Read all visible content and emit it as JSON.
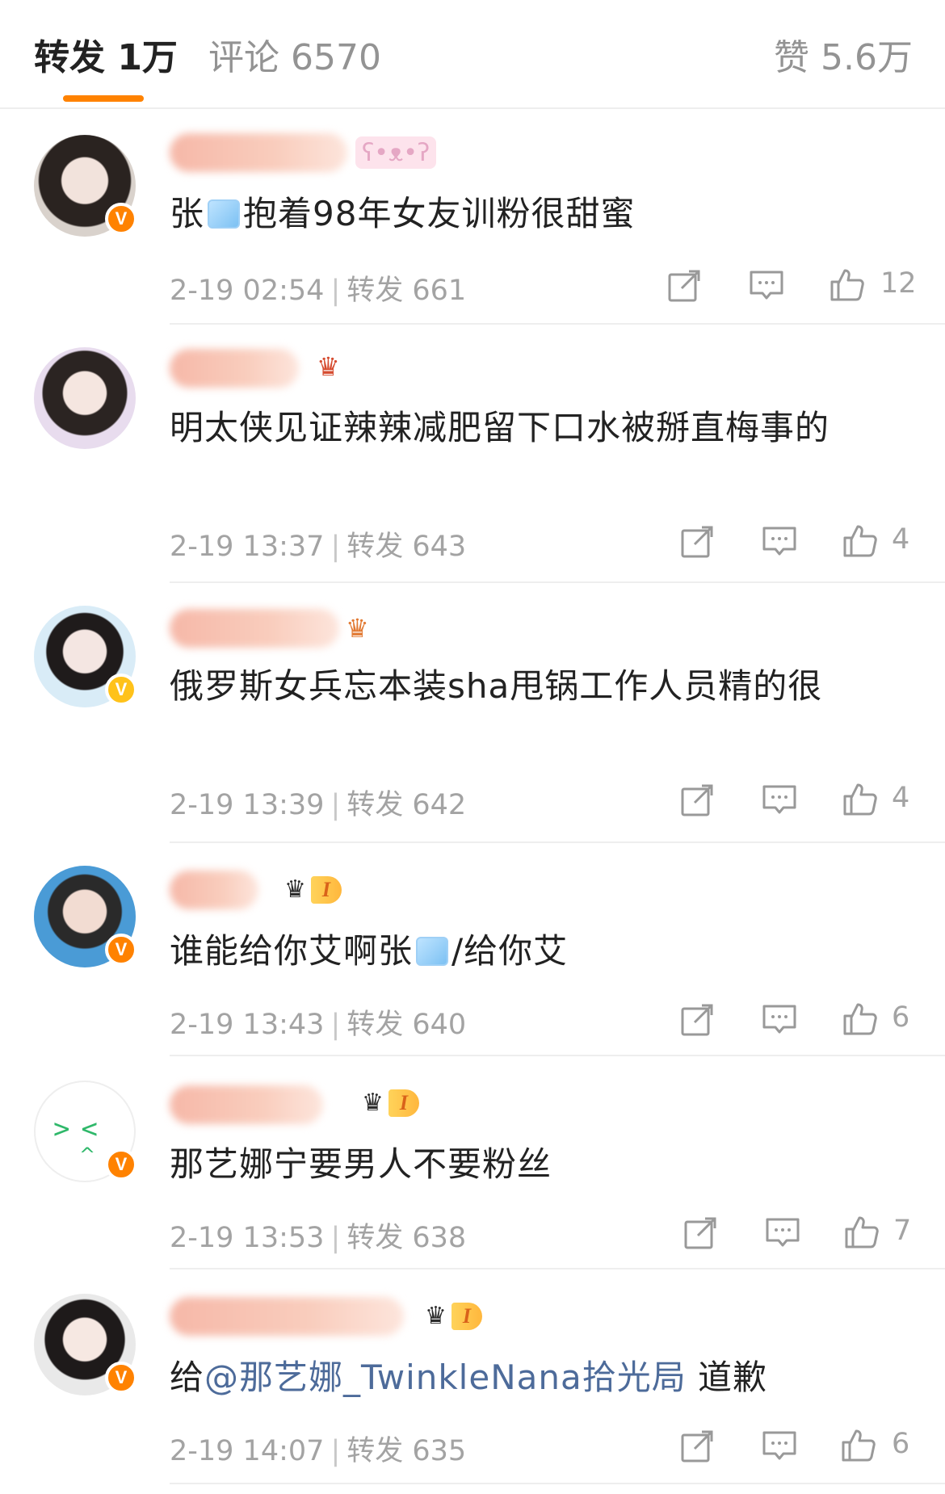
{
  "tabs": {
    "repost": "转发 1万",
    "comments": "评论 6570",
    "likes": "赞 5.6万"
  },
  "colors": {
    "accent": "#ff8200",
    "mention": "#4d6b9a",
    "meta": "#a3a3a3"
  },
  "comments": [
    {
      "text_a": "张",
      "text_b": "抱着98年女友训粉很甜蜜",
      "date": "2-19 02:54",
      "repost": "转发 661",
      "likes": "12",
      "badge": "bear-icon"
    },
    {
      "text": "明太侠见证辣辣减肥留下口水被掰直梅事的",
      "date": "2-19 13:37",
      "repost": "转发 643",
      "likes": "4",
      "badge": "gem-icon"
    },
    {
      "text": "俄罗斯女兵忘本装sha甩锅工作人员精的很",
      "date": "2-19 13:39",
      "repost": "转发 642",
      "likes": "4",
      "badge": "gem-icon"
    },
    {
      "text_a": "谁能给你艾啊张",
      "text_b": "/给你艾",
      "date": "2-19 13:43",
      "repost": "转发 640",
      "likes": "6",
      "badge_level": "I"
    },
    {
      "text": "那艺娜宁要男人不要粉丝",
      "date": "2-19 13:53",
      "repost": "转发 638",
      "likes": "7",
      "badge_level": "I"
    },
    {
      "text_a": "给",
      "mention": "@那艺娜_TwinkleNana拾光局",
      "text_b": " 道歉",
      "date": "2-19 14:07",
      "repost": "转发 635",
      "likes": "6",
      "badge_level": "I"
    }
  ]
}
